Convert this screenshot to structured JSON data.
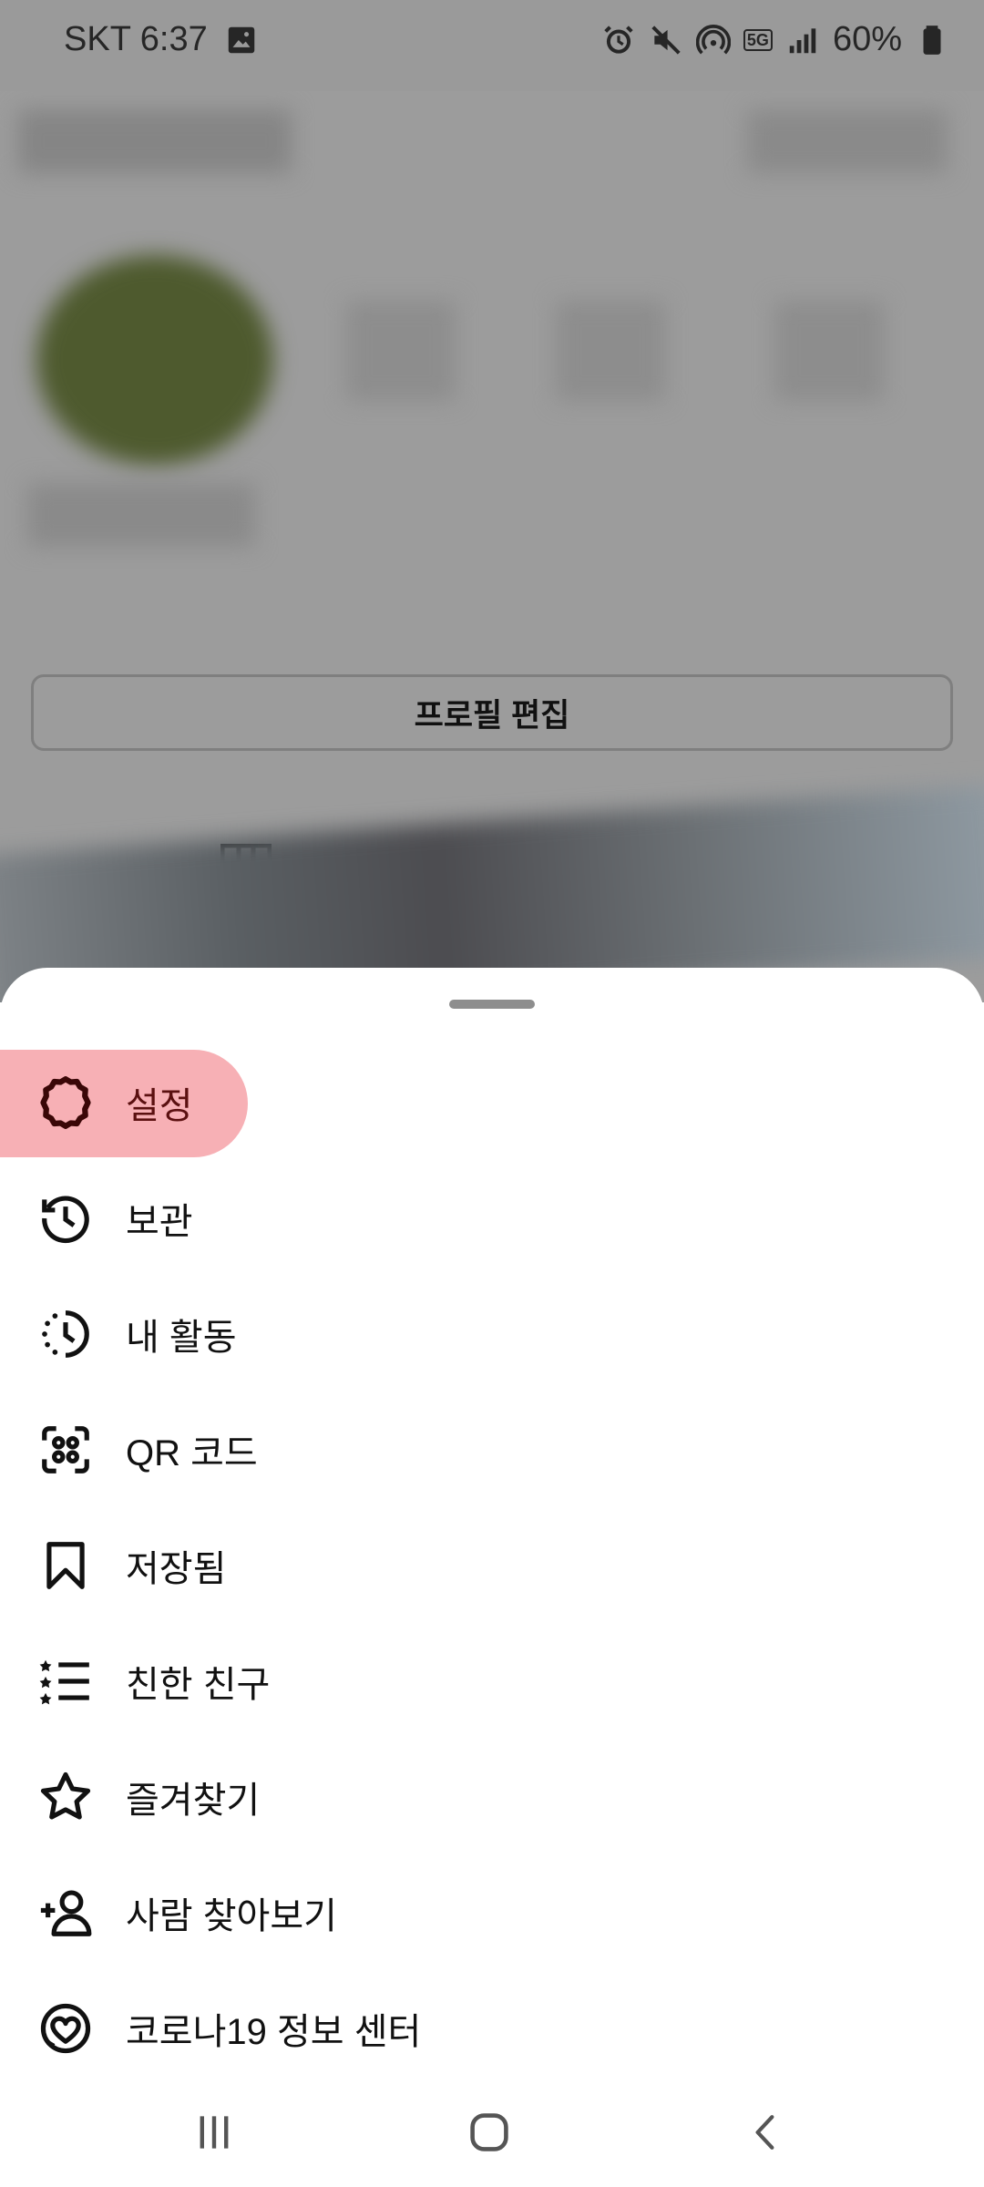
{
  "status_bar": {
    "carrier_time": "SKT 6:37",
    "battery": "60%",
    "network_badge": "5G",
    "icons_left": [
      "image-icon"
    ],
    "icons_right": [
      "alarm-icon",
      "mute-icon",
      "hotspot-icon",
      "5g-icon",
      "signal-icon",
      "battery-icon"
    ]
  },
  "profile": {
    "edit_button": "프로필 편집"
  },
  "menu": {
    "items": [
      {
        "label": "설정",
        "icon": "settings-icon"
      },
      {
        "label": "보관",
        "icon": "archive-icon"
      },
      {
        "label": "내 활동",
        "icon": "activity-icon"
      },
      {
        "label": "QR 코드",
        "icon": "qr-code-icon"
      },
      {
        "label": "저장됨",
        "icon": "bookmark-icon"
      },
      {
        "label": "친한 친구",
        "icon": "close-friends-icon"
      },
      {
        "label": "즐겨찾기",
        "icon": "star-icon"
      },
      {
        "label": "사람 찾아보기",
        "icon": "add-person-icon"
      },
      {
        "label": "코로나19 정보 센터",
        "icon": "covid-info-icon"
      }
    ],
    "highlight_color": "#f6a7ad"
  },
  "nav_bar": {
    "icons": [
      "recent-apps-icon",
      "home-icon",
      "back-icon"
    ]
  }
}
